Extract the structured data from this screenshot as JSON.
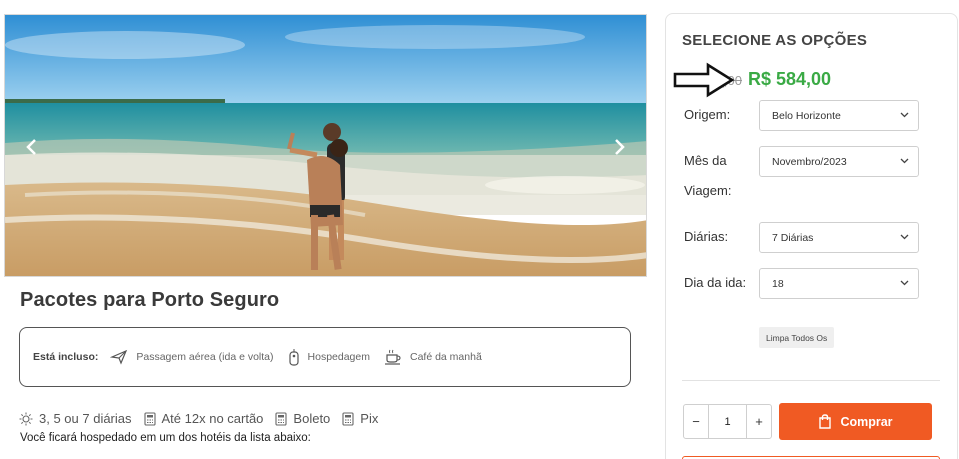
{
  "product": {
    "title": "Pacotes para Porto Seguro",
    "includes_label": "Está incluso:",
    "includes": [
      {
        "icon": "airplane-icon",
        "label": "Passagem aérea (ida e volta)"
      },
      {
        "icon": "hotel-tag-icon",
        "label": "Hospedagem"
      },
      {
        "icon": "coffee-cup-icon",
        "label": "Café da manhã"
      }
    ],
    "features": [
      {
        "icon": "sun-icon",
        "label": "3, 5 ou 7 diárias"
      },
      {
        "icon": "calculator-icon",
        "label": "Até 12x no cartão"
      },
      {
        "icon": "calculator-icon",
        "label": "Boleto"
      },
      {
        "icon": "calculator-icon",
        "label": "Pix"
      }
    ],
    "hotel_text": "Você ficará hospedado em um dos hotéis da lista abaixo:"
  },
  "sidebar": {
    "heading": "SELECIONE AS OPÇÕES",
    "old_price": "R$ 7__,00",
    "new_price": "R$ 584,00",
    "options": {
      "origin_label": "Origem:",
      "origin_value": "Belo Horizonte",
      "month_label_1": "Mês da",
      "month_label_2": "Viagem:",
      "month_value": "Novembro/2023",
      "nights_label": "Diárias:",
      "nights_value": "7 Diárias",
      "day_label": "Dia da ida:",
      "day_value": "18"
    },
    "clear_label": "Limpa Todos Os",
    "quantity": "1",
    "minus": "−",
    "plus": "+",
    "buy_label": "Comprar"
  },
  "colors": {
    "accent": "#f05a23",
    "price_green": "#3aaa45"
  }
}
